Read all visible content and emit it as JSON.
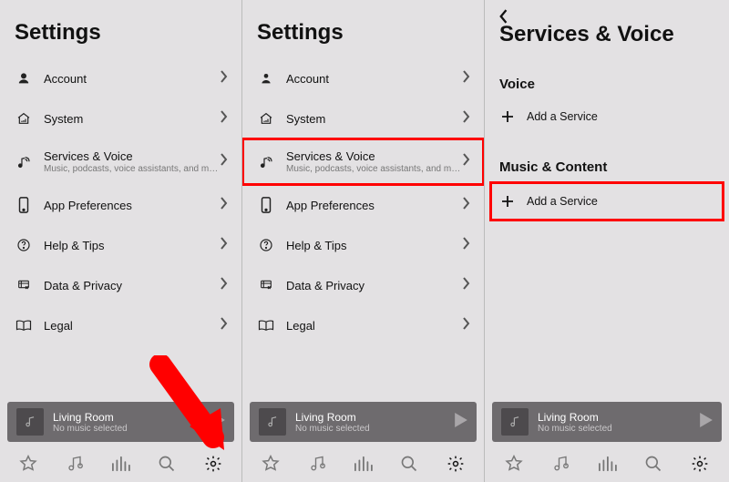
{
  "screens": {
    "settings": {
      "title": "Settings",
      "items": [
        {
          "label": "Account",
          "sub": ""
        },
        {
          "label": "System",
          "sub": ""
        },
        {
          "label": "Services & Voice",
          "sub": "Music, podcasts, voice assistants, and more"
        },
        {
          "label": "App Preferences",
          "sub": ""
        },
        {
          "label": "Help & Tips",
          "sub": ""
        },
        {
          "label": "Data & Privacy",
          "sub": ""
        },
        {
          "label": "Legal",
          "sub": ""
        }
      ]
    },
    "services": {
      "title": "Services & Voice",
      "voice_header": "Voice",
      "music_header": "Music & Content",
      "add_label": "Add a Service"
    }
  },
  "nowplaying": {
    "room": "Living Room",
    "status": "No music selected"
  }
}
